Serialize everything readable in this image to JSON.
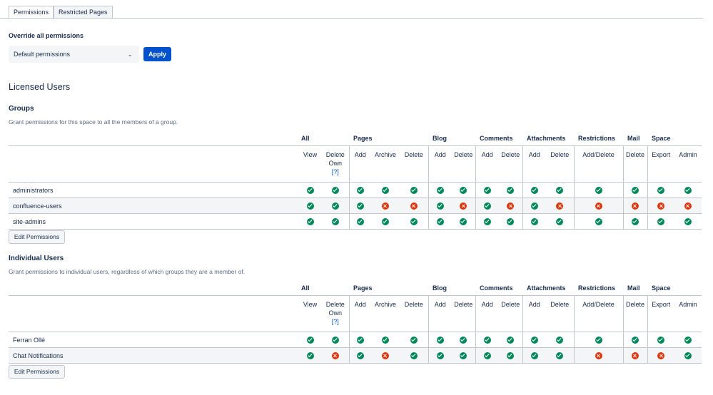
{
  "tabs": [
    {
      "label": "Permissions",
      "active": true
    },
    {
      "label": "Restricted Pages",
      "active": false
    }
  ],
  "override": {
    "title": "Override all permissions",
    "select_value": "Default permissions",
    "apply_label": "Apply"
  },
  "licensed_title": "Licensed Users",
  "colors": {
    "accent": "#0052cc",
    "granted": "#00875a",
    "denied": "#de350b"
  },
  "permission_columns": {
    "groups": [
      {
        "label": "All",
        "span": 2
      },
      {
        "label": "Pages",
        "span": 3
      },
      {
        "label": "Blog",
        "span": 2
      },
      {
        "label": "Comments",
        "span": 2
      },
      {
        "label": "Attachments",
        "span": 2
      },
      {
        "label": "Restrictions",
        "span": 1
      },
      {
        "label": "Mail",
        "span": 1
      },
      {
        "label": "Space",
        "span": 2
      }
    ],
    "sub": [
      "View",
      "Delete Own",
      "Add",
      "Archive",
      "Delete",
      "Add",
      "Delete",
      "Add",
      "Delete",
      "Add",
      "Delete",
      "Add/Delete",
      "Delete",
      "Export",
      "Admin"
    ],
    "help": "[?]"
  },
  "groups_section": {
    "title": "Groups",
    "description": "Grant permissions for this space to all the members of a group.",
    "rows": [
      {
        "name": "administrators",
        "perms": [
          1,
          1,
          1,
          1,
          1,
          1,
          1,
          1,
          1,
          1,
          1,
          1,
          1,
          1,
          1
        ]
      },
      {
        "name": "confluence-users",
        "perms": [
          1,
          1,
          1,
          0,
          0,
          1,
          0,
          1,
          0,
          1,
          0,
          0,
          0,
          0,
          0
        ]
      },
      {
        "name": "site-admins",
        "perms": [
          1,
          1,
          1,
          1,
          1,
          1,
          1,
          1,
          1,
          1,
          1,
          1,
          1,
          1,
          1
        ]
      }
    ],
    "edit_label": "Edit Permissions"
  },
  "users_section": {
    "title": "Individual Users",
    "description": "Grant permissions to individual users, regardless of which groups they are a member of.",
    "rows": [
      {
        "name": "Ferran Ollé",
        "perms": [
          1,
          1,
          1,
          1,
          1,
          1,
          1,
          1,
          1,
          1,
          1,
          1,
          1,
          1,
          1
        ]
      },
      {
        "name": "Chat Notifications",
        "perms": [
          1,
          0,
          1,
          0,
          1,
          1,
          1,
          1,
          1,
          1,
          1,
          0,
          0,
          0,
          1
        ]
      }
    ],
    "edit_label": "Edit Permissions"
  }
}
